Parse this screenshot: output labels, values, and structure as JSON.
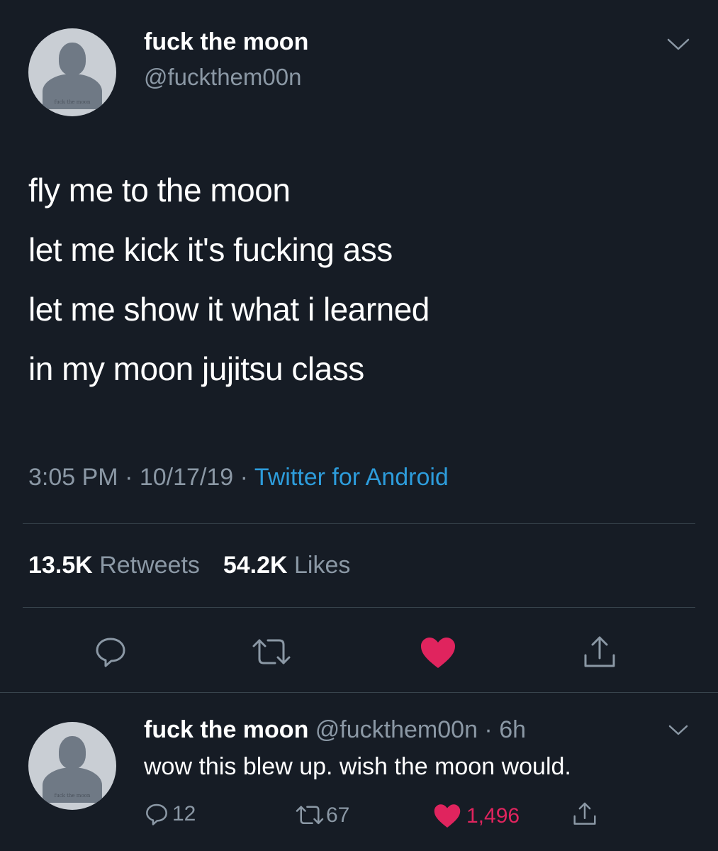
{
  "tweet": {
    "author": {
      "display_name": "fuck the moon",
      "handle": "@fuckthem00n",
      "avatar_caption": "fuck the moon"
    },
    "text_lines": [
      "fly me to the moon",
      "let me kick it's fucking ass",
      "let me show it what i learned",
      "in my moon jujitsu class"
    ],
    "time": "3:05 PM",
    "date": "10/17/19",
    "source": "Twitter for Android",
    "stats": {
      "retweets_count": "13.5K",
      "retweets_label": "Retweets",
      "likes_count": "54.2K",
      "likes_label": "Likes"
    },
    "actions": [
      "reply",
      "retweet",
      "like",
      "share"
    ],
    "liked": true
  },
  "reply": {
    "author": {
      "display_name": "fuck the moon",
      "handle": "@fuckthem00n",
      "avatar_caption": "fuck the moon"
    },
    "age": "6h",
    "text": "wow this blew up. wish the moon would.",
    "counts": {
      "replies": "12",
      "retweets": "67",
      "likes": "1,496"
    },
    "liked": true
  },
  "colors": {
    "background": "#161c25",
    "text": "#ffffff",
    "muted": "#8b98a5",
    "link": "#2d9cdb",
    "like": "#e0245e",
    "divider": "#38444d"
  }
}
